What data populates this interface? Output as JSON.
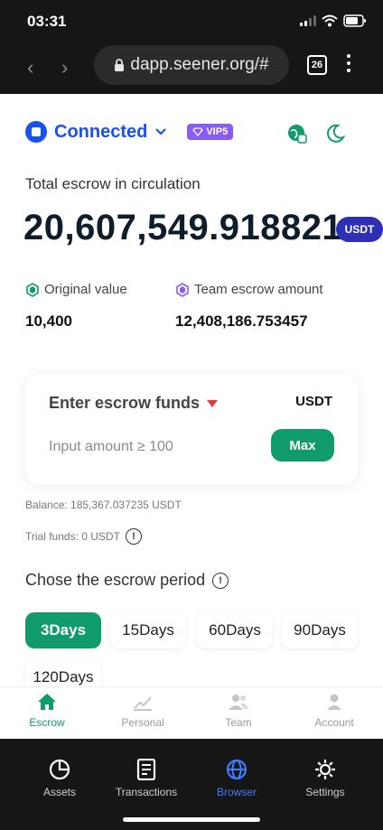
{
  "status_bar": {
    "time": "03:31"
  },
  "browser": {
    "url": "dapp.seener.org/#",
    "tab_count": "26"
  },
  "header": {
    "connection_label": "Connected",
    "vip_label": "VIP5"
  },
  "summary": {
    "total_label": "Total escrow in circulation",
    "total_value": "20,607,549.918821",
    "total_currency": "USDT",
    "original_label": "Original value",
    "original_value": "10,400",
    "team_label": "Team escrow amount",
    "team_value": "12,408,186.753457"
  },
  "escrow_form": {
    "title": "Enter escrow funds",
    "currency": "USDT",
    "input_placeholder": "Input amount ≥ 100",
    "max_label": "Max"
  },
  "balance_text": "Balance: 185,367.037235 USDT",
  "trial_funds_text": "Trial funds: 0 USDT",
  "info_glyph": "!",
  "period": {
    "title": "Chose the escrow period",
    "options": [
      "3Days",
      "15Days",
      "60Days",
      "90Days",
      "120Days"
    ],
    "selected": "3Days"
  },
  "dapp_nav": {
    "items": [
      {
        "label": "Escrow",
        "icon": "home-icon"
      },
      {
        "label": "Personal",
        "icon": "chart-icon"
      },
      {
        "label": "Team",
        "icon": "team-icon"
      },
      {
        "label": "Account",
        "icon": "person-icon"
      }
    ],
    "active": "Escrow"
  },
  "browser_nav": {
    "items": [
      {
        "label": "Assets",
        "icon": "pie-icon"
      },
      {
        "label": "Transactions",
        "icon": "document-icon"
      },
      {
        "label": "Browser",
        "icon": "globe-icon"
      },
      {
        "label": "Settings",
        "icon": "gear-icon"
      }
    ],
    "active": "Browser"
  },
  "colors": {
    "accent_green": "#0f9b6b",
    "connected_blue": "#1652f0",
    "vip_purple": "#8a5cf6",
    "usdt_badge": "#2d2fb5",
    "browser_active": "#3f7cff"
  }
}
